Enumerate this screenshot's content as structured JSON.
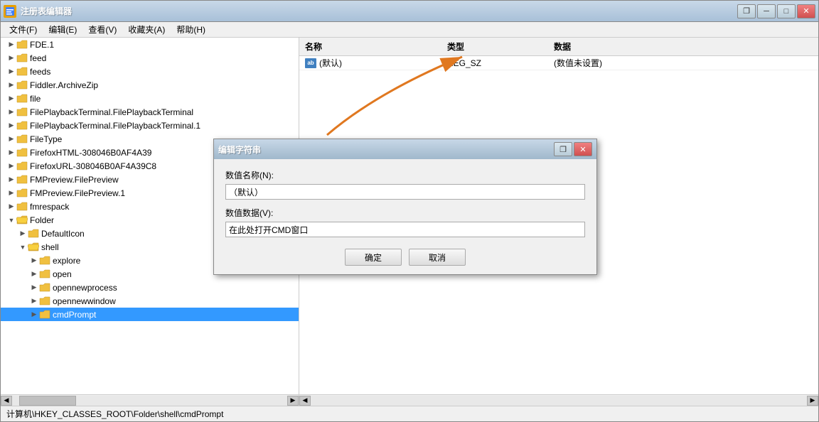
{
  "window": {
    "title": "注册表编辑器",
    "icon_label": "R"
  },
  "menu": {
    "items": [
      "文件(F)",
      "编辑(E)",
      "查看(V)",
      "收藏夹(A)",
      "帮助(H)"
    ]
  },
  "tree": {
    "items": [
      {
        "id": "fde1",
        "label": "FDE.1",
        "indent": 1,
        "expanded": false,
        "level": 1
      },
      {
        "id": "feed",
        "label": "feed",
        "indent": 1,
        "expanded": false,
        "level": 1
      },
      {
        "id": "feeds",
        "label": "feeds",
        "indent": 1,
        "expanded": false,
        "level": 1
      },
      {
        "id": "fiddler",
        "label": "Fiddler.ArchiveZip",
        "indent": 1,
        "expanded": false,
        "level": 1
      },
      {
        "id": "file",
        "label": "file",
        "indent": 1,
        "expanded": false,
        "level": 1
      },
      {
        "id": "filepb1",
        "label": "FilePlaybackTerminal.FilePlaybackTerminal",
        "indent": 1,
        "expanded": false,
        "level": 1
      },
      {
        "id": "filepb2",
        "label": "FilePlaybackTerminal.FilePlaybackTerminal.1",
        "indent": 1,
        "expanded": false,
        "level": 1
      },
      {
        "id": "filetype",
        "label": "FileType",
        "indent": 1,
        "expanded": false,
        "level": 1
      },
      {
        "id": "firefoxhtml",
        "label": "FirefoxHTML-308046B0AF4A39",
        "indent": 1,
        "expanded": false,
        "level": 1
      },
      {
        "id": "firefoxurl",
        "label": "FirefoxURL-308046B0AF4A39C8",
        "indent": 1,
        "expanded": false,
        "level": 1
      },
      {
        "id": "fmpreview1",
        "label": "FMPreview.FilePreview",
        "indent": 1,
        "expanded": false,
        "level": 1
      },
      {
        "id": "fmpreview2",
        "label": "FMPreview.FilePreview.1",
        "indent": 1,
        "expanded": false,
        "level": 1
      },
      {
        "id": "fmrespack",
        "label": "fmrespack",
        "indent": 1,
        "expanded": false,
        "level": 1
      },
      {
        "id": "folder",
        "label": "Folder",
        "indent": 1,
        "expanded": true,
        "level": 1
      },
      {
        "id": "defaulticon",
        "label": "DefaultIcon",
        "indent": 2,
        "expanded": false,
        "level": 2
      },
      {
        "id": "shell",
        "label": "shell",
        "indent": 2,
        "expanded": true,
        "level": 2
      },
      {
        "id": "explore",
        "label": "explore",
        "indent": 3,
        "expanded": false,
        "level": 3
      },
      {
        "id": "open",
        "label": "open",
        "indent": 3,
        "expanded": false,
        "level": 3
      },
      {
        "id": "opennewprocess",
        "label": "opennewprocess",
        "indent": 3,
        "expanded": false,
        "level": 3
      },
      {
        "id": "opennewwindow",
        "label": "opennewwindow",
        "indent": 3,
        "expanded": false,
        "level": 3
      },
      {
        "id": "cmdprompt",
        "label": "cmdPrompt",
        "indent": 3,
        "expanded": false,
        "level": 3,
        "selected": true
      }
    ]
  },
  "right_panel": {
    "headers": [
      "名称",
      "类型",
      "数据"
    ],
    "rows": [
      {
        "name": "(默认)",
        "type": "REG_SZ",
        "data": "(数值未设置)"
      }
    ]
  },
  "dialog": {
    "title": "编辑字符串",
    "close_btn": "✕",
    "restore_btn": "❐",
    "name_label": "数值名称(N):",
    "name_value": "（默认）",
    "data_label": "数值数据(V):",
    "data_value": "在此处打开CMD窗口",
    "ok_btn": "确定",
    "cancel_btn": "取消"
  },
  "status_bar": {
    "text": "计算机\\HKEY_CLASSES_ROOT\\Folder\\shell\\cmdPrompt"
  }
}
